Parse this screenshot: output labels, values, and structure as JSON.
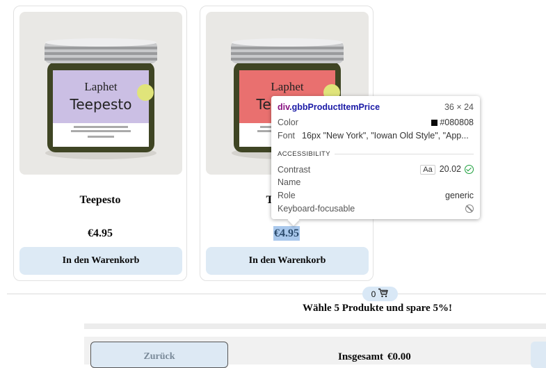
{
  "products": [
    {
      "jar_line1": "Laphet",
      "jar_line2": "Teepesto",
      "jar_label_color": "#cbbfe4",
      "title": "Teepesto",
      "price": "€4.95",
      "add_label": "In den Warenkorb"
    },
    {
      "jar_line1": "Laphet",
      "jar_line2": "Teepesto",
      "jar_label_color": "#e9706f",
      "title": "Teepesto",
      "price": "€4.95",
      "add_label": "In den Warenkorb"
    }
  ],
  "cart": {
    "count": "0",
    "icon": "cart-icon"
  },
  "promo": "Wähle 5 Produkte und spare 5%!",
  "footer": {
    "back_label": "Zurück",
    "total_label": "Insgesamt",
    "total_value": "€0.00"
  },
  "inspector": {
    "tag": "div",
    "class_name": ".gbbProductItemPrice",
    "size": "36 × 24",
    "color_label": "Color",
    "color_value": "#080808",
    "font_label": "Font",
    "font_value": "16px \"New York\", \"Iowan Old Style\", \"App...",
    "accessibility_heading": "ACCESSIBILITY",
    "contrast_label": "Contrast",
    "contrast_aa": "Aa",
    "contrast_value": "20.02",
    "name_label": "Name",
    "role_label": "Role",
    "role_value": "generic",
    "keyboard_label": "Keyboard-focusable"
  }
}
